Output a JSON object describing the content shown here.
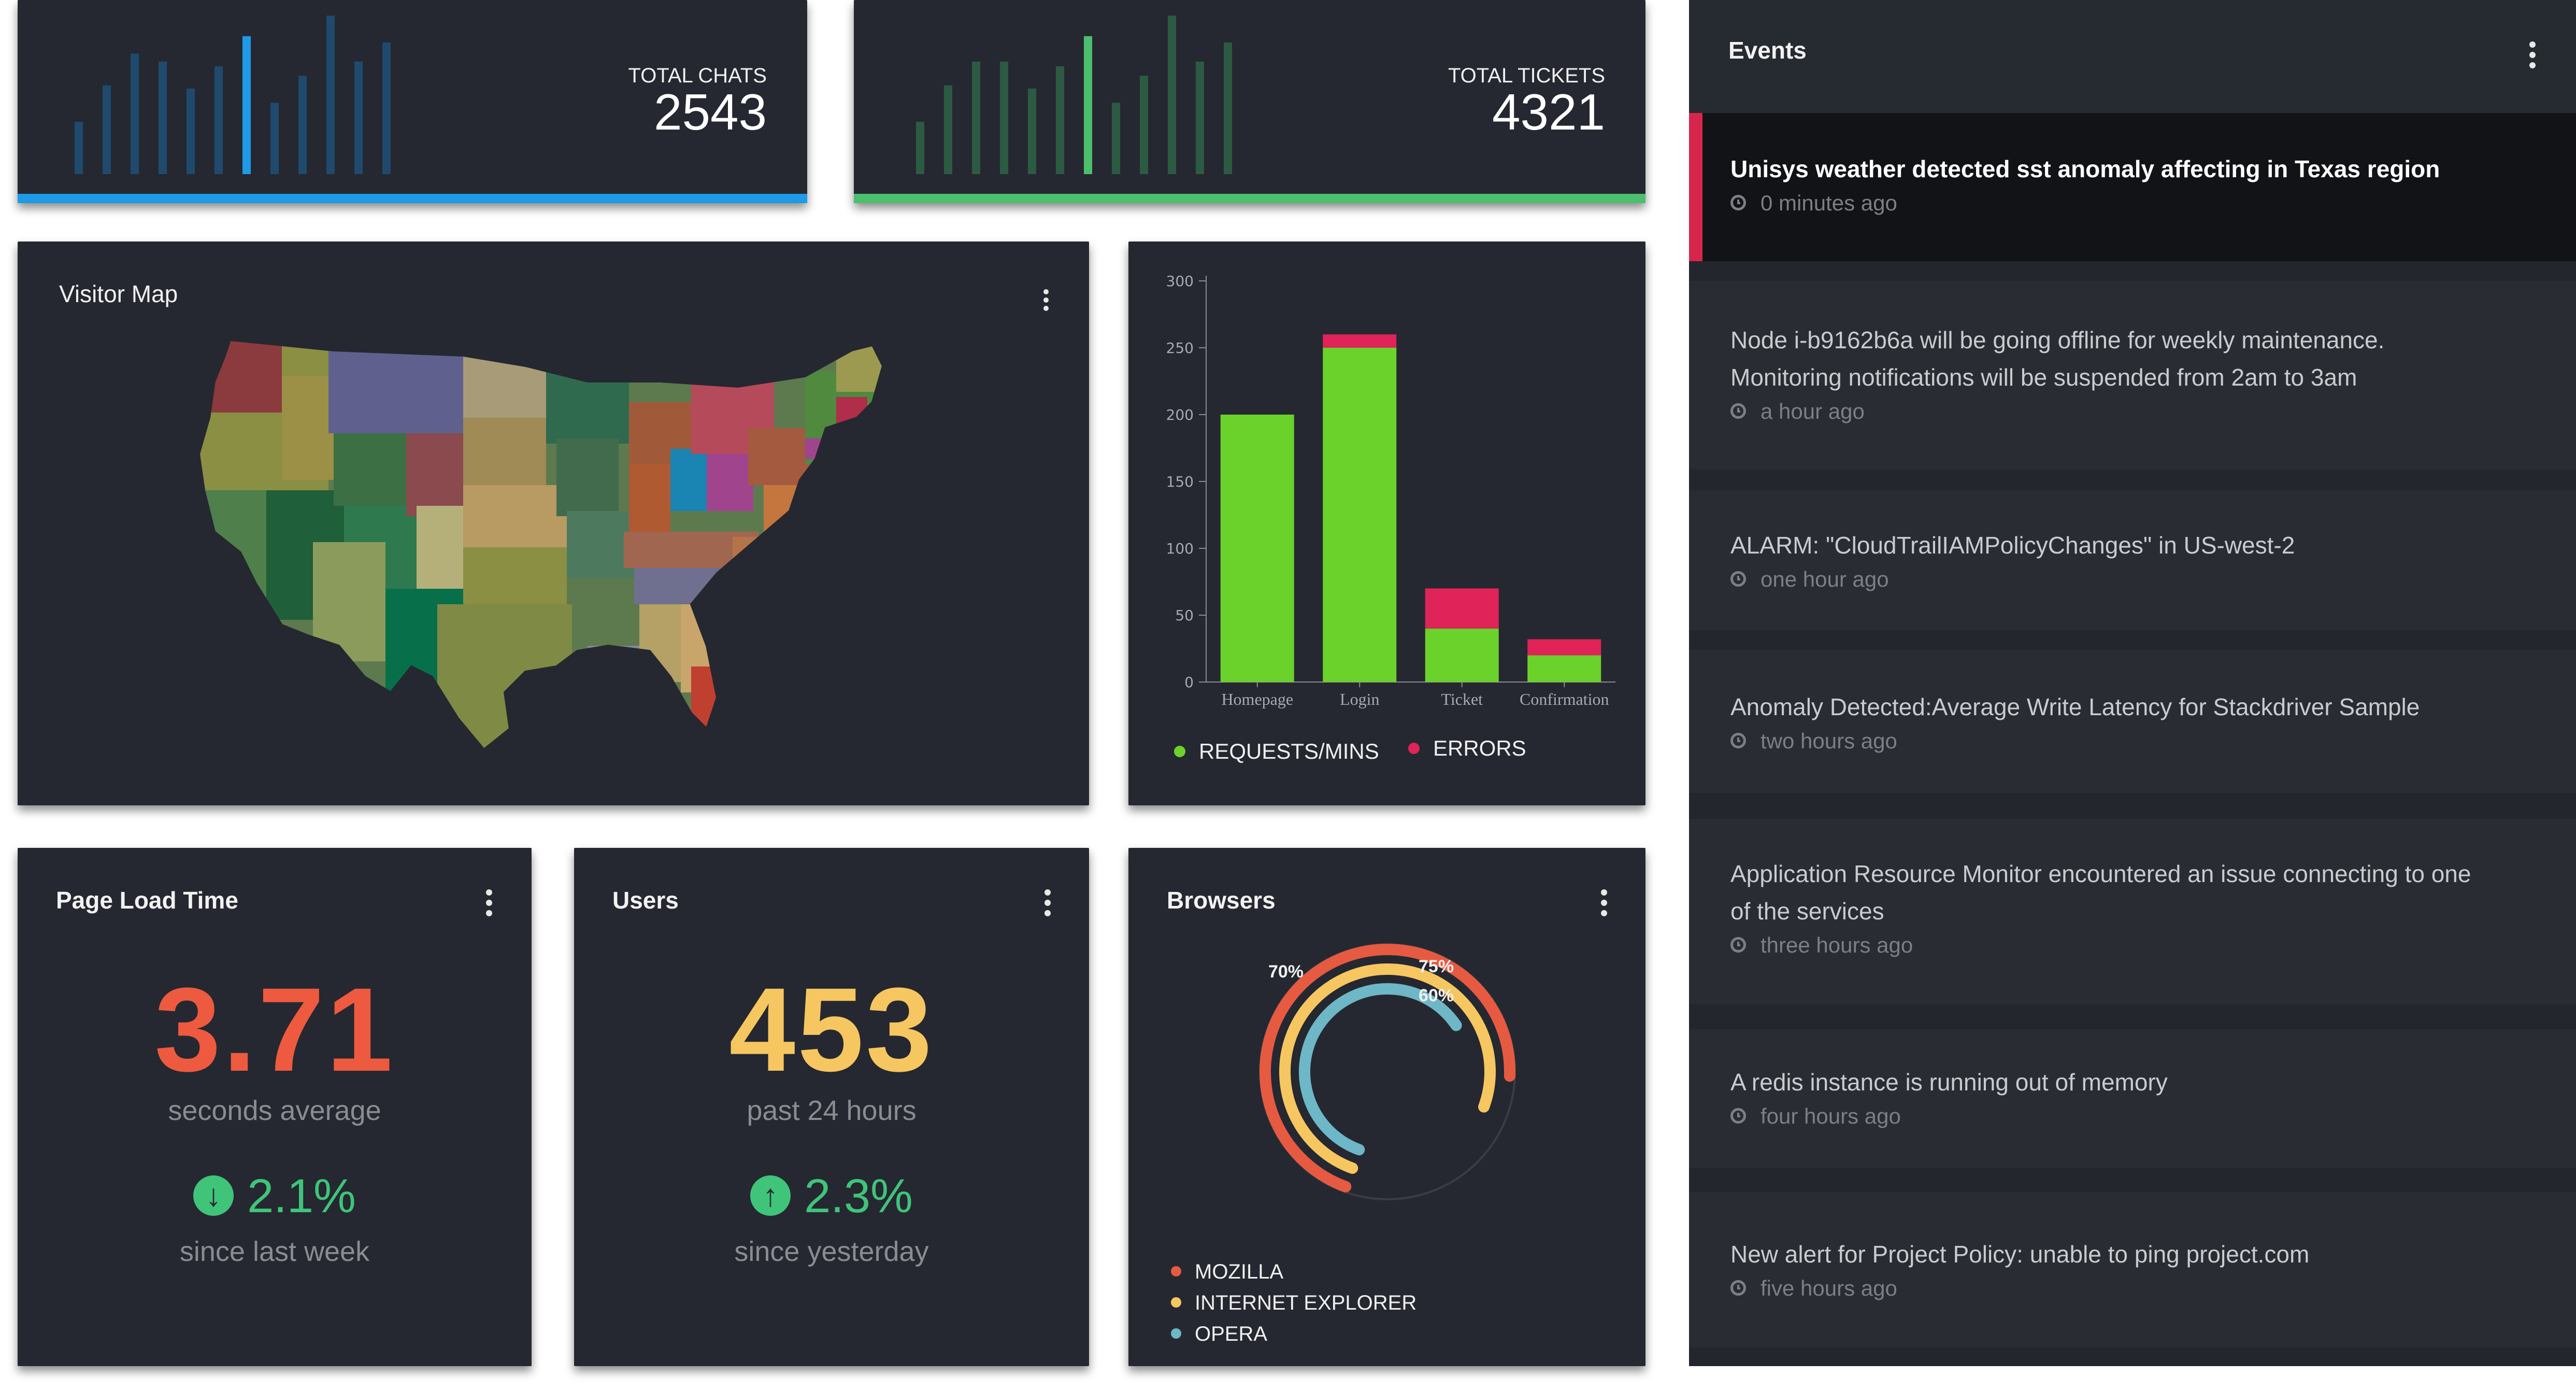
{
  "colors": {
    "blue": "#1e9ae6",
    "green": "#4cbf6e",
    "red_metric": "#ee5a3f",
    "yellow_metric": "#f6c661",
    "up_down_green": "#3fc47a",
    "bar_green": "#6bd12b",
    "bar_red": "#e02358",
    "mozilla": "#e65a41",
    "ie": "#f6c661",
    "opera": "#6db7c6",
    "alert_marker": "#d7264c"
  },
  "total_chats": {
    "label": "TOTAL CHATS",
    "value": "2543",
    "sparkline": [
      0.33,
      0.56,
      0.76,
      0.71,
      0.54,
      0.68,
      0.87,
      0.45,
      0.62,
      1.0,
      0.71,
      0.83
    ],
    "highlight_index": 6
  },
  "total_tickets": {
    "label": "TOTAL TICKETS",
    "value": "4321",
    "sparkline": [
      0.33,
      0.56,
      0.71,
      0.71,
      0.54,
      0.68,
      0.87,
      0.45,
      0.62,
      1.0,
      0.71,
      0.83
    ],
    "highlight_index": 6
  },
  "visitor_map": {
    "title": "Visitor Map",
    "icon": "usa-map-icon"
  },
  "chart_data": {
    "type": "bar",
    "stacked": true,
    "categories": [
      "Homepage",
      "Login",
      "Ticket",
      "Confirmation"
    ],
    "series": [
      {
        "name": "REQUESTS/MINS",
        "values": [
          200,
          250,
          40,
          20
        ],
        "color": "#6bd12b"
      },
      {
        "name": "ERRORS",
        "values": [
          0,
          10,
          30,
          12
        ],
        "color": "#e02358"
      }
    ],
    "ylim": [
      0,
      300
    ],
    "yticks": [
      0,
      50,
      100,
      150,
      200,
      250,
      300
    ],
    "legend": "bottom"
  },
  "page_load": {
    "title": "Page Load Time",
    "value": "3.71",
    "sub": "seconds average",
    "change": "2.1%",
    "direction": "down",
    "change_sub": "since last week"
  },
  "users": {
    "title": "Users",
    "value": "453",
    "sub": "past 24 hours",
    "change": "2.3%",
    "direction": "up",
    "change_sub": "since yesterday"
  },
  "browsers": {
    "title": "Browsers",
    "rings": [
      {
        "name": "MOZILLA",
        "percent": 70,
        "label": "70%",
        "color": "#e65a41"
      },
      {
        "name": "INTERNET EXPLORER",
        "percent": 75,
        "label": "75%",
        "color": "#f6c661"
      },
      {
        "name": "OPERA",
        "percent": 60,
        "label": "60%",
        "color": "#6db7c6"
      }
    ]
  },
  "events": {
    "title": "Events",
    "items": [
      {
        "text": "Unisys weather detected sst anomaly affecting in Texas region",
        "time": "0 minutes ago",
        "highlighted": true
      },
      {
        "text": "Node i-b9162b6a will be going offline for weekly maintenance.",
        "text2": "Monitoring notifications will be suspended from 2am to 3am",
        "time": "a hour ago"
      },
      {
        "text": "ALARM: \"CloudTrailIAMPolicyChanges\" in US-west-2",
        "time": "one hour ago"
      },
      {
        "text": "Anomaly Detected:Average Write Latency for Stackdriver Sample",
        "time": "two hours ago"
      },
      {
        "text": "Application Resource Monitor encountered an issue connecting to one",
        "text2": "of the services",
        "time": "three hours ago"
      },
      {
        "text": "A redis instance is running out of memory",
        "time": "four hours ago"
      },
      {
        "text": "New alert for Project Policy: unable to ping project.com",
        "time": "five hours ago"
      }
    ]
  }
}
